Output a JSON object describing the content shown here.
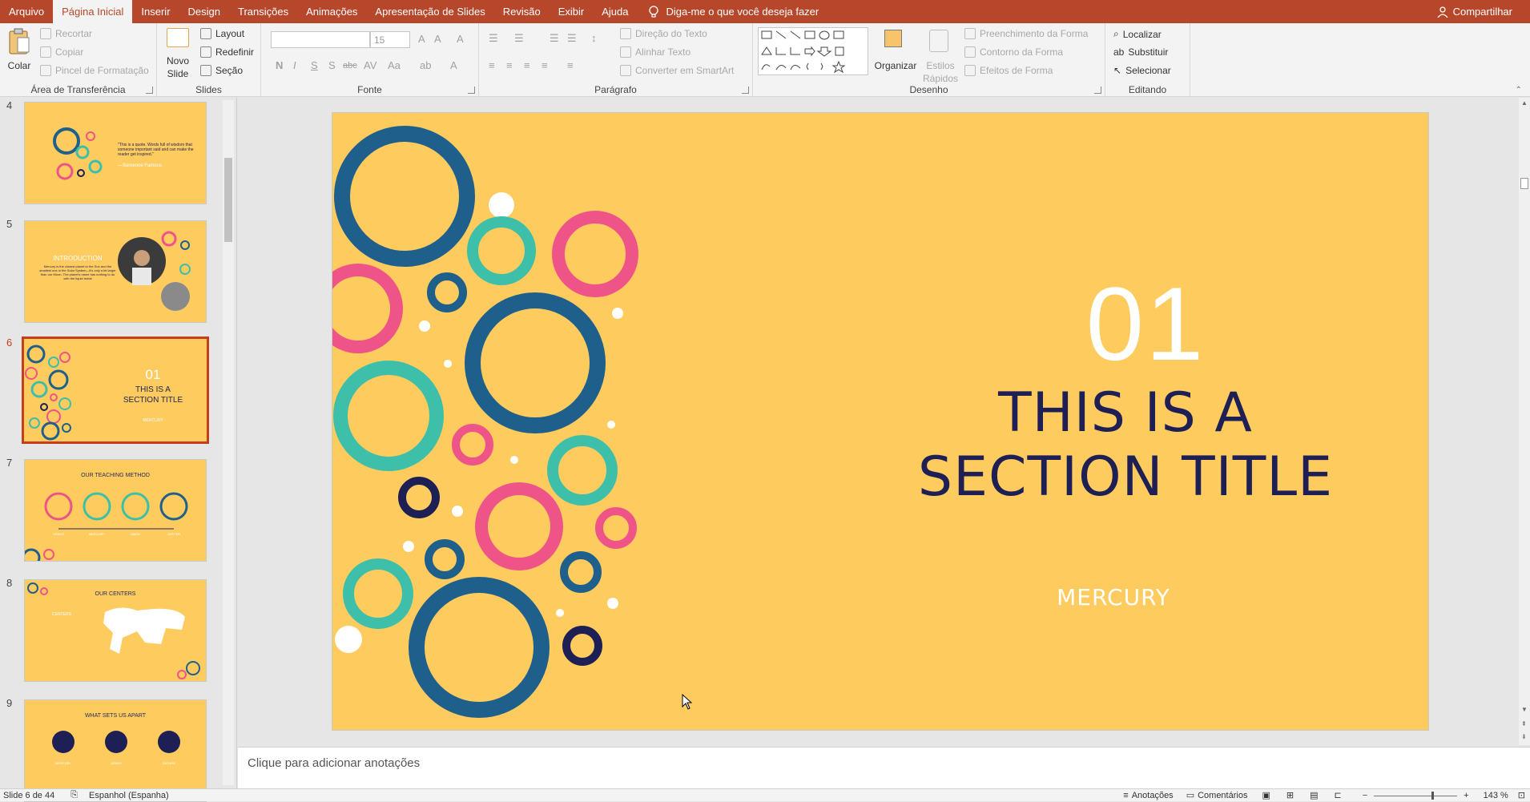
{
  "menu": {
    "tabs": [
      "Arquivo",
      "Página Inicial",
      "Inserir",
      "Design",
      "Transições",
      "Animações",
      "Apresentação de Slides",
      "Revisão",
      "Exibir",
      "Ajuda"
    ],
    "active_tab": "Página Inicial",
    "tell_me": "Diga-me o que você deseja fazer",
    "share": "Compartilhar"
  },
  "ribbon": {
    "clipboard": {
      "paste": "Colar",
      "cut": "Recortar",
      "copy": "Copiar",
      "format_painter": "Pincel de Formatação",
      "label": "Área de Transferência"
    },
    "slides": {
      "new_slide_1": "Novo",
      "new_slide_2": "Slide",
      "layout": "Layout",
      "reset": "Redefinir",
      "section": "Seção",
      "label": "Slides"
    },
    "font": {
      "size": "15",
      "bold": "N",
      "italic": "I",
      "underline": "S",
      "shadow": "S",
      "strike": "abc",
      "label": "Fonte"
    },
    "paragraph": {
      "text_direction": "Direção do Texto",
      "align_text": "Alinhar Texto",
      "smartart": "Converter em SmartArt",
      "label": "Parágrafo"
    },
    "drawing": {
      "arrange": "Organizar",
      "quick_styles_1": "Estilos",
      "quick_styles_2": "Rápidos",
      "shape_fill": "Preenchimento da Forma",
      "shape_outline": "Contorno da Forma",
      "shape_effects": "Efeitos de Forma",
      "label": "Desenho"
    },
    "editing": {
      "find": "Localizar",
      "replace": "Substituir",
      "select": "Selecionar",
      "label": "Editando"
    }
  },
  "thumbnails": [
    {
      "num": "4",
      "caption": "\"This is a quote. Words full of wisdom that someone important said and can make the reader get inspired.\"",
      "sub": "—Someone Famous"
    },
    {
      "num": "5",
      "title": "INTRODUCTION",
      "caption": "Mercury is the closest planet to the Sun and the smallest one in the Solar System—it's only a bit larger than our Moon. The planet's name has nothing to do with the liquid metal"
    },
    {
      "num": "6",
      "title": "01",
      "caption": "THIS IS A SECTION TITLE",
      "sub": "MERCURY"
    },
    {
      "num": "7",
      "title": "OUR TEACHING METHOD",
      "labels": [
        "VENUS",
        "MERCURY",
        "MARS",
        "JUPITER"
      ]
    },
    {
      "num": "8",
      "title": "OUR CENTERS",
      "sub": "CENTERS"
    },
    {
      "num": "9",
      "title": "WHAT SETS US APART",
      "labels": [
        "MERCURY",
        "VENUS",
        "SATURN"
      ]
    }
  ],
  "slide": {
    "number": "01",
    "title_line1": "THIS IS A",
    "title_line2": "SECTION TITLE",
    "subtitle": "MERCURY",
    "bg_color": "#fecb5f",
    "colors": {
      "navy": "#1f5f8b",
      "teal": "#3ebfaa",
      "pink": "#ef5489",
      "dark": "#1e2055",
      "white": "#ffffff"
    }
  },
  "notes": {
    "placeholder": "Clique para adicionar anotações"
  },
  "status": {
    "slide_info": "Slide 6 de 44",
    "language": "Espanhol (Espanha)",
    "notes": "Anotações",
    "comments": "Comentários",
    "zoom": "143 %"
  }
}
